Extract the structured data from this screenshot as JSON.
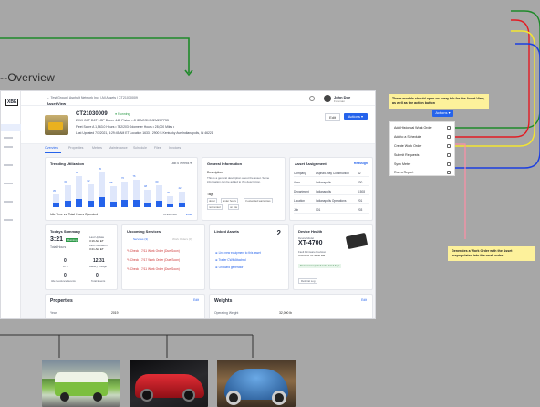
{
  "canvas": {
    "overview_title": "--Overview"
  },
  "app": {
    "logo": "XBE",
    "breadcrumb": "← Test Group | Asphalt Network Inc. | All Assets | CT21030009",
    "page_label": "Asset View",
    "user": {
      "name": "John Doe",
      "role": "Foreman"
    },
    "asset": {
      "id": "CT21030009",
      "status": "Running",
      "description": "2019 CAT D6T LGP Dozer 440 Piston • JHDAGSXCJ2M207733",
      "meta_line1": "Fleet Score  A  1,563.0 Hours •  782/203 Odometer Hours •  28,000 Miles •",
      "meta_line2": "Last Updated  7/3/2021, 4:29:45 AM ET   Location  1633 - 2900 S Kentucky Ave Indianapolis, IN 46221",
      "edit_label": "Edit",
      "actions_label": "Actions ▾"
    },
    "tabs": [
      "Overview",
      "Properties",
      "Meters",
      "Maintenance",
      "Schedule",
      "Files",
      "Invoices"
    ],
    "trending": {
      "title": "Trending Utilization",
      "filter": "Last 6 Weeks ▾",
      "values": [
        35,
        60,
        84,
        62,
        95,
        58,
        70,
        76,
        48,
        60,
        30,
        42
      ],
      "caption": "Idle Time vs. Total Hours Operated",
      "legend": [
        "OPERATED",
        "IDLE"
      ]
    },
    "general": {
      "title": "General Information",
      "description_label": "Description",
      "description": "This is a general description about the asset. Some information can be added to this description.",
      "tags_label": "Tags",
      "tags": [
        "dozer",
        "under hours",
        "3 extended warranties",
        "not rented",
        "on site"
      ]
    },
    "assignment": {
      "title": "Asset Assignment",
      "link": "Reassign",
      "rows": [
        [
          "Company",
          "Asphalt-Way Construction",
          "42"
        ],
        [
          "Area",
          "Indianapolis",
          "230"
        ],
        [
          "Department",
          "Indianapolis",
          "4,508"
        ],
        [
          "Location",
          "Indianapolis Operations",
          "201"
        ],
        [
          "Job",
          "001",
          "203"
        ]
      ]
    },
    "summary": {
      "title": "Todays Summary",
      "time": "3:21",
      "time_badge": "Running",
      "time_label": "Total Hours",
      "last_update": "Last Update",
      "last_time": "3:16 AM ET",
      "last_util": "Last Utilization",
      "last_util_val": "3:21 AM ET",
      "stats": [
        {
          "value": "0",
          "label": "DTC"
        },
        {
          "value": "12.31",
          "label": "Battery Voltage"
        },
        {
          "value": "0",
          "label": "Idle Geofence Events"
        },
        {
          "value": "0",
          "label": "Total Events"
        }
      ]
    },
    "services": {
      "title": "Upcoming Services",
      "tabs": [
        "Services (3)",
        "Work Orders (0)"
      ],
      "items": [
        "Check - 7/11 Work Order (Due Soon)",
        "Check - 7/17 Work Order (Due Soon)",
        "Check - 7/11 Work Order (Due Soon)"
      ]
    },
    "linked": {
      "title": "Linked Assets",
      "count": "2",
      "items": [
        "Link new equipment to this asset",
        "Trailer CW4 Attached",
        "Onboard generator"
      ]
    },
    "device": {
      "title": "Device Health",
      "model_label": "Device Model",
      "model": "XT-4700",
      "fw_label": "Fault Firmware Revision",
      "fw": "7/20/2021 01:49:30 PM",
      "status": "Device last reported in the last 3 days",
      "link": "Referral Log"
    },
    "properties": {
      "title": "Properties",
      "edit": "Edit",
      "row_label": "Year",
      "row_value": "2019"
    },
    "weights": {
      "title": "Weights",
      "edit": "Edit",
      "row_label": "Operating Weight",
      "row_value": "32,000 lb"
    }
  },
  "panel": {
    "note_top": "These modals should open on every tab for the Asset View, as well as the action button",
    "actions_button": "Actions ▾",
    "menu_items": [
      "Add Historical Work Order",
      "Add to a Schedule",
      "Create Work Order",
      "Submit Requests",
      "Sync Meter",
      "Run a Report"
    ],
    "note_bottom": "Generates a Work Order with the Asset prepopulated into the work order."
  },
  "colors": {
    "accent": "#2563eb",
    "line_green": "#1f8a2a",
    "line_red": "#e31b23",
    "line_yellow": "#f4e531",
    "line_blue": "#1c3fe0",
    "line_pink": "#ff8fa6"
  }
}
